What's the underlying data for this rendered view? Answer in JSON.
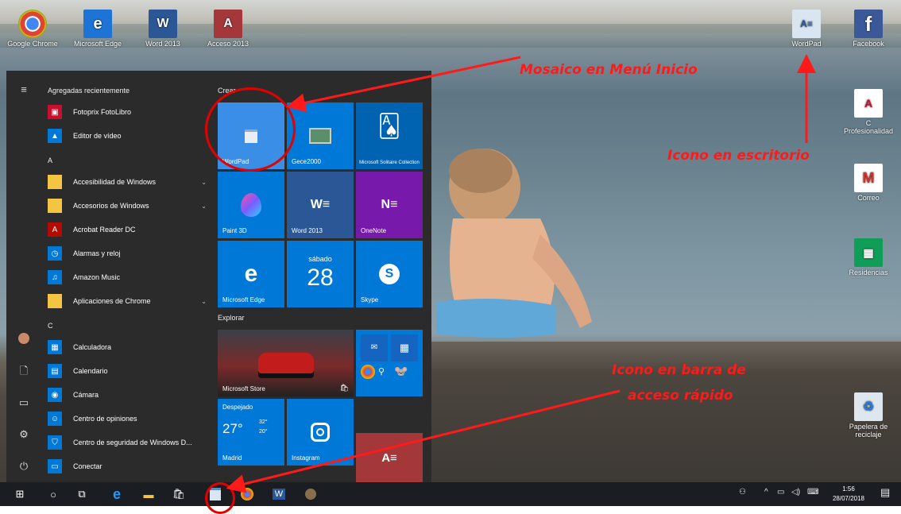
{
  "desktop_icons_top": [
    {
      "label": "Google Chrome",
      "icon": "chrome-icon",
      "color": "#4285f4"
    },
    {
      "label": "Microsoft Edge",
      "icon": "edge-icon",
      "color": "#1e74d6"
    },
    {
      "label": "Word 2013",
      "icon": "word-icon",
      "color": "#2b5797"
    },
    {
      "label": "Acceso 2013",
      "icon": "access-icon",
      "color": "#a4373a"
    }
  ],
  "desktop_icons_right": [
    {
      "label": "WordPad",
      "icon": "wordpad-icon",
      "color": "#d9e6f2"
    },
    {
      "label": "Facebook",
      "icon": "facebook-icon",
      "color": "#3b5998"
    },
    {
      "label": "C Profesionalidad",
      "icon": "pdf-icon",
      "color": "#ffffff"
    },
    {
      "label": "Correo",
      "icon": "gmail-icon",
      "color": "#ffffff"
    },
    {
      "label": "Residencias",
      "icon": "sheets-icon",
      "color": "#0f9d58"
    },
    {
      "label": "Papelera de reciclaje",
      "icon": "recycle-bin-icon",
      "color": "#dfe7ee"
    }
  ],
  "start_menu": {
    "recent_header": "Agregadas recientemente",
    "recent": [
      {
        "label": "Fotoprix FotoLibro",
        "color": "#c8102e"
      },
      {
        "label": "Editor de vídeo",
        "color": "#0078d7"
      }
    ],
    "letter_a": "A",
    "group_a": [
      {
        "label": "Accesibilidad de Windows",
        "color": "#f4c542",
        "chevron": true
      },
      {
        "label": "Accesorios de Windows",
        "color": "#f4c542",
        "chevron": true
      },
      {
        "label": "Acrobat Reader DC",
        "color": "#b30b00",
        "chevron": false
      },
      {
        "label": "Alarmas y reloj",
        "color": "#0078d7",
        "chevron": false
      },
      {
        "label": "Amazon Music",
        "color": "#0078d7",
        "chevron": false
      },
      {
        "label": "Aplicaciones de Chrome",
        "color": "#f4c542",
        "chevron": true
      }
    ],
    "letter_c": "C",
    "group_c": [
      {
        "label": "Calculadora",
        "color": "#0078d7"
      },
      {
        "label": "Calendario",
        "color": "#0078d7"
      },
      {
        "label": "Cámara",
        "color": "#0078d7"
      },
      {
        "label": "Centro de opiniones",
        "color": "#0078d7"
      },
      {
        "label": "Centro de seguridad de Windows D...",
        "color": "#0078d7"
      },
      {
        "label": "Conectar",
        "color": "#0078d7"
      }
    ],
    "tiles_group_crear": "Crear",
    "tiles_group_explorar": "Explorar",
    "tiles": {
      "wordpad": "WordPad",
      "gece": "Gece2000",
      "solitaire": "Microsoft Solitaire Collection",
      "paint3d": "Paint 3D",
      "word": "Word 2013",
      "onenote": "OneNote",
      "edge": "Microsoft Edge",
      "calendar_day": "sábado",
      "calendar_date": "28",
      "skype": "Skype",
      "store": "Microsoft Store",
      "weather_cond": "Despejado",
      "weather_temp": "27°",
      "weather_hi": "32°",
      "weather_lo": "20°",
      "weather_city": "Madrid",
      "instagram": "Instagram"
    }
  },
  "taskbar": {
    "clock_time": "1:56",
    "clock_date": "28/07/2018"
  },
  "annotations": {
    "tile": "Mosaico en Menú Inicio",
    "desktop": "Icono en escritorio",
    "taskbar_line1": "Icono en barra de",
    "taskbar_line2": "acceso rápido"
  }
}
